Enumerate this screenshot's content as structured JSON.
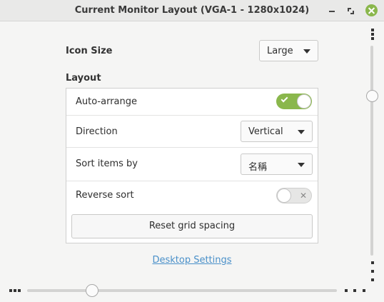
{
  "window": {
    "title": "Current Monitor Layout (VGA-1 - 1280x1024)"
  },
  "icon_size": {
    "label": "Icon Size",
    "value": "Large"
  },
  "layout": {
    "heading": "Layout",
    "auto_arrange": {
      "label": "Auto-arrange",
      "checked": true
    },
    "direction": {
      "label": "Direction",
      "value": "Vertical"
    },
    "sort_by": {
      "label": "Sort items by",
      "value": "名稱"
    },
    "reverse_sort": {
      "label": "Reverse sort",
      "checked": false
    },
    "reset_button": "Reset grid spacing"
  },
  "desktop_settings_link": "Desktop Settings",
  "colors": {
    "accent": "#8ab74c",
    "link": "#4a90c9"
  },
  "icons": [
    "minimize-icon",
    "maximize-icon",
    "close-icon",
    "check-icon",
    "x-icon",
    "chevron-down-icon",
    "drag-handle-icon"
  ]
}
